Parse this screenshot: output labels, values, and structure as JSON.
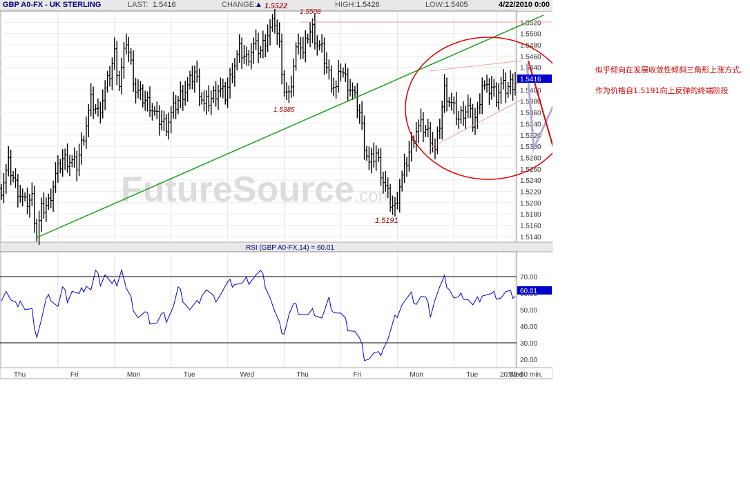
{
  "header": {
    "symbol": "GBP A0-FX - UK STERLING",
    "last_label": "LAST:",
    "last_value": "1.5416",
    "change_label": "CHANGE:",
    "change_symbol": "▲",
    "change_value": "1.5522",
    "high_label": "HIGH:",
    "high_value": "1.5426",
    "low_label": "LOW:",
    "low_value": "1.5405",
    "date": "4/22/2010 0:00"
  },
  "colors": {
    "price_bars": "#000000",
    "rsi_line": "#0000cc",
    "trendline": "#1a9e1a",
    "annotation": "#dd0000",
    "triangle_lines": "#f0a0a0",
    "projection_line": "#b0a8d8",
    "last_price_tag": "#0000cc"
  },
  "watermark": {
    "main": "FutureSource",
    "suffix": ".com"
  },
  "annotations": {
    "peak_high": "1.5522",
    "peak_2": "1.5508",
    "mid_low": "1.5385",
    "major_low": "1.5191"
  },
  "notes": {
    "line1": "似乎倾向在发展收敛性倾斜三角形上涨方式,",
    "line2": "作为价格自1.5191向上反弹的终端阶段"
  },
  "chart_data": [
    {
      "type": "bar",
      "title": "GBP A0-FX - UK STERLING",
      "subtitle": "hourly OHLC price bars",
      "ylim": [
        1.513,
        1.554
      ],
      "yticks": [
        "1.5520",
        "1.5500",
        "1.5480",
        "1.5460",
        "1.5440",
        "1.5420",
        "1.5400",
        "1.5380",
        "1.5360",
        "1.5340",
        "1.5320",
        "1.5300",
        "1.5280",
        "1.5260",
        "1.5240",
        "1.5220",
        "1.5200",
        "1.5180",
        "1.5160",
        "1.5140"
      ],
      "last_value": "1.5416",
      "categories": [
        "Thu",
        "Fri",
        "Mon",
        "Tue",
        "Wed",
        "Thu",
        "Fri",
        "Mon",
        "Tue",
        "Wed",
        "20:00"
      ],
      "interval_label": "60 min.",
      "anchors": [
        [
          0,
          1.5225
        ],
        [
          3,
          1.5268
        ],
        [
          6,
          1.5232
        ],
        [
          10,
          1.5198
        ],
        [
          13,
          1.5208
        ],
        [
          15,
          1.5143
        ],
        [
          17,
          1.5186
        ],
        [
          20,
          1.52
        ],
        [
          23,
          1.5248
        ],
        [
          26,
          1.5278
        ],
        [
          29,
          1.5275
        ],
        [
          32,
          1.5266
        ],
        [
          36,
          1.534
        ],
        [
          38,
          1.538
        ],
        [
          41,
          1.536
        ],
        [
          43,
          1.5385
        ],
        [
          46,
          1.5428
        ],
        [
          48,
          1.5465
        ],
        [
          50,
          1.541
        ],
        [
          53,
          1.5488
        ],
        [
          55,
          1.5445
        ],
        [
          57,
          1.54
        ],
        [
          60,
          1.5385
        ],
        [
          63,
          1.5375
        ],
        [
          66,
          1.535
        ],
        [
          70,
          1.5338
        ],
        [
          73,
          1.5365
        ],
        [
          76,
          1.539
        ],
        [
          79,
          1.5405
        ],
        [
          82,
          1.5432
        ],
        [
          84,
          1.54
        ],
        [
          86,
          1.5372
        ],
        [
          89,
          1.5385
        ],
        [
          92,
          1.5402
        ],
        [
          95,
          1.539
        ],
        [
          98,
          1.5435
        ],
        [
          101,
          1.547
        ],
        [
          104,
          1.5455
        ],
        [
          107,
          1.5478
        ],
        [
          110,
          1.547
        ],
        [
          113,
          1.55
        ],
        [
          116,
          1.5522
        ],
        [
          118,
          1.5478
        ],
        [
          120,
          1.54
        ],
        [
          122,
          1.5385
        ],
        [
          124,
          1.5442
        ],
        [
          126,
          1.5495
        ],
        [
          128,
          1.5462
        ],
        [
          130,
          1.5498
        ],
        [
          132,
          1.5508
        ],
        [
          134,
          1.5482
        ],
        [
          136,
          1.547
        ],
        [
          138,
          1.544
        ],
        [
          140,
          1.5415
        ],
        [
          142,
          1.5402
        ],
        [
          144,
          1.544
        ],
        [
          146,
          1.542
        ],
        [
          149,
          1.5395
        ],
        [
          152,
          1.536
        ],
        [
          154,
          1.5305
        ],
        [
          156,
          1.5268
        ],
        [
          159,
          1.5288
        ],
        [
          162,
          1.524
        ],
        [
          165,
          1.52
        ],
        [
          167,
          1.5191
        ],
        [
          169,
          1.5232
        ],
        [
          171,
          1.5258
        ],
        [
          173,
          1.529
        ],
        [
          176,
          1.533
        ],
        [
          178,
          1.5335
        ],
        [
          180,
          1.533
        ],
        [
          182,
          1.5318
        ],
        [
          184,
          1.529
        ],
        [
          186,
          1.534
        ],
        [
          188,
          1.54
        ],
        [
          190,
          1.5382
        ],
        [
          192,
          1.5365
        ],
        [
          194,
          1.5348
        ],
        [
          196,
          1.5362
        ],
        [
          198,
          1.5368
        ],
        [
          200,
          1.5342
        ],
        [
          202,
          1.536
        ],
        [
          204,
          1.5412
        ],
        [
          206,
          1.5398
        ],
        [
          208,
          1.5405
        ],
        [
          210,
          1.539
        ],
        [
          212,
          1.5408
        ],
        [
          214,
          1.5402
        ],
        [
          216,
          1.541
        ],
        [
          218,
          1.5416
        ]
      ]
    },
    {
      "type": "line",
      "title": "RSI (GBP A0-FX,14) = 60.01",
      "ylim": [
        15,
        85
      ],
      "yticks": [
        "70.00",
        "60.00",
        "50.00",
        "40.00",
        "30.00",
        "20.00"
      ],
      "reference_lines": [
        70,
        30
      ],
      "last_value": "60.01",
      "anchors": [
        [
          0,
          58
        ],
        [
          2,
          62
        ],
        [
          4,
          55
        ],
        [
          6,
          52
        ],
        [
          8,
          57
        ],
        [
          10,
          50
        ],
        [
          13,
          48
        ],
        [
          15,
          35
        ],
        [
          17,
          44
        ],
        [
          19,
          55
        ],
        [
          21,
          58
        ],
        [
          24,
          52
        ],
        [
          26,
          62
        ],
        [
          28,
          57
        ],
        [
          30,
          62
        ],
        [
          33,
          58
        ],
        [
          36,
          66
        ],
        [
          38,
          62
        ],
        [
          40,
          72
        ],
        [
          42,
          67
        ],
        [
          44,
          72
        ],
        [
          47,
          64
        ],
        [
          49,
          67
        ],
        [
          51,
          75
        ],
        [
          53,
          62
        ],
        [
          56,
          52
        ],
        [
          58,
          46
        ],
        [
          61,
          47
        ],
        [
          63,
          44
        ],
        [
          66,
          42
        ],
        [
          68,
          46
        ],
        [
          70,
          45
        ],
        [
          73,
          52
        ],
        [
          75,
          62
        ],
        [
          78,
          55
        ],
        [
          80,
          50
        ],
        [
          83,
          53
        ],
        [
          85,
          60
        ],
        [
          87,
          62
        ],
        [
          90,
          56
        ],
        [
          93,
          60
        ],
        [
          96,
          65
        ],
        [
          99,
          67
        ],
        [
          102,
          65
        ],
        [
          105,
          68
        ],
        [
          108,
          71
        ],
        [
          110,
          72
        ],
        [
          112,
          66
        ],
        [
          114,
          58
        ],
        [
          116,
          48
        ],
        [
          118,
          40
        ],
        [
          120,
          37
        ],
        [
          122,
          47
        ],
        [
          124,
          52
        ],
        [
          127,
          49
        ],
        [
          130,
          46
        ],
        [
          133,
          49
        ],
        [
          136,
          45
        ],
        [
          139,
          55
        ],
        [
          141,
          50
        ],
        [
          144,
          47
        ],
        [
          147,
          40
        ],
        [
          150,
          37
        ],
        [
          152,
          31
        ],
        [
          154,
          22
        ],
        [
          156,
          21
        ],
        [
          158,
          23
        ],
        [
          160,
          22
        ],
        [
          162,
          28
        ],
        [
          164,
          32
        ],
        [
          166,
          40
        ],
        [
          168,
          48
        ],
        [
          170,
          54
        ],
        [
          172,
          56
        ],
        [
          174,
          58
        ],
        [
          176,
          55
        ],
        [
          178,
          58
        ],
        [
          180,
          56
        ],
        [
          182,
          48
        ],
        [
          184,
          57
        ],
        [
          186,
          63
        ],
        [
          188,
          68
        ],
        [
          190,
          64
        ],
        [
          192,
          57
        ],
        [
          194,
          56
        ],
        [
          196,
          59
        ],
        [
          198,
          57
        ],
        [
          200,
          52
        ],
        [
          202,
          55
        ],
        [
          204,
          60
        ],
        [
          206,
          59
        ],
        [
          208,
          58
        ],
        [
          210,
          59
        ],
        [
          212,
          58
        ],
        [
          214,
          60
        ],
        [
          216,
          59
        ],
        [
          218,
          60
        ]
      ]
    }
  ]
}
